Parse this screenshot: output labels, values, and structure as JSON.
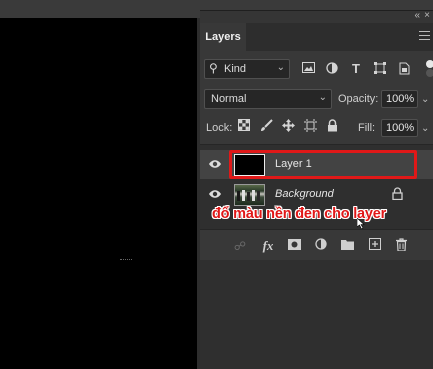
{
  "panel": {
    "tab_label": "Layers",
    "collapse_glyph": "«",
    "close_glyph": "×",
    "filter": {
      "kind_label": "Kind",
      "icons": [
        "image-filter-icon",
        "adjustment-filter-icon",
        "type-filter-icon",
        "shape-filter-icon",
        "smart-object-filter-icon"
      ]
    },
    "blend_mode": "Normal",
    "opacity_label": "Opacity:",
    "opacity_value": "100%",
    "lock_label": "Lock:",
    "fill_label": "Fill:",
    "fill_value": "100%"
  },
  "layers": [
    {
      "name": "Layer 1",
      "visible": true,
      "selected": true,
      "thumbnail": "black",
      "locked": false
    },
    {
      "name": "Background",
      "visible": true,
      "selected": false,
      "thumbnail": "photo",
      "locked": true
    }
  ],
  "annotation": {
    "text": "đổ màu nền đen cho layer",
    "color": "#e11717"
  },
  "bottom_icons": [
    "link-layers-icon",
    "fx-icon",
    "mask-icon",
    "adjustment-layer-icon",
    "group-folder-icon",
    "new-layer-icon",
    "trash-icon"
  ]
}
